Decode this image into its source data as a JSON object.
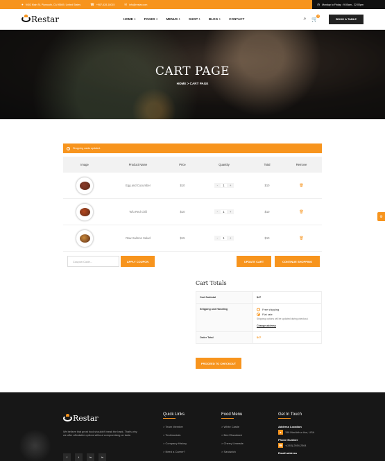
{
  "topbar": {
    "address": "9402 Main St, Plymouth, CA 95669, United States",
    "phone": "+987-628-18015",
    "email": "info@restar.com",
    "hours": "Monday to Friday : 9:00am - 22:00pm"
  },
  "brand": {
    "name": "Restar"
  },
  "nav": [
    {
      "label": "HOME +"
    },
    {
      "label": "PAGES +"
    },
    {
      "label": "MENUS +"
    },
    {
      "label": "SHOP +"
    },
    {
      "label": "BLOG +"
    },
    {
      "label": "CONTACT"
    }
  ],
  "header": {
    "cart_count": "0",
    "book_label": "BOOK A TABLE"
  },
  "hero": {
    "title": "CART PAGE",
    "crumb_home": "HOME",
    "crumb_sep": ">",
    "crumb_current": "CART PAGE"
  },
  "notice": {
    "text": "Shopping cards updated."
  },
  "table": {
    "headers": [
      "Image",
      "Product Name",
      "Price",
      "Quantity",
      "Total",
      "Remove"
    ],
    "rows": [
      {
        "name": "Egg and Cucumber",
        "price": "$10",
        "qty": "1",
        "total": "$10",
        "color": "#8a3b2a"
      },
      {
        "name": "Tofu Red Chili",
        "price": "$10",
        "qty": "1",
        "total": "$10",
        "color": "#b5481e"
      },
      {
        "name": "Raw Salmon Salad",
        "price": "$15",
        "qty": "1",
        "total": "$10",
        "color": "#c98a3a"
      }
    ],
    "qty_minus": "-",
    "qty_plus": "+"
  },
  "coupon": {
    "placeholder": "Coupon Code...",
    "apply_label": "APPLY COUPON",
    "update_label": "UPDATE CART",
    "continue_label": "CONTINUE SHOPPING"
  },
  "totals": {
    "title": "Cart Totals",
    "subtotal_label": "Cart Subtotal",
    "subtotal_value": "$47",
    "shipping_label": "Shipping and Handling",
    "option_free": "Free shipping",
    "option_flat": "Flat rate",
    "shipping_note": "Shipping options will be updated during checkout.",
    "change_address": "Change address",
    "order_total_label": "Order Total",
    "order_total_value": "$47",
    "checkout_label": "PROCEED TO CHECKOUT",
    "accent": "#f7941d"
  },
  "footer": {
    "about": "We believe that great food shouldn't break the bank. That's why we offer affordable options without compromising on taste.",
    "social": [
      "f",
      "t",
      "in",
      "in"
    ],
    "quick_links_title": "Quick Links",
    "quick_links": [
      "> Team Member",
      "> Testimonials",
      "> Company History",
      "> Need a Career?"
    ],
    "food_menu_title": "Food Menu",
    "food_menu": [
      "> White Castle",
      "> Beef Sandwich",
      "> Cherry Limeade",
      "> Sandwich"
    ],
    "touch_title": "Get In Touch",
    "address_label": "Address Location",
    "address_value": "158 MacArthur Ave, USA",
    "phone_label": "Phone Number",
    "phone_value": "+(163)-2654-2564",
    "email_label": "Email address"
  }
}
